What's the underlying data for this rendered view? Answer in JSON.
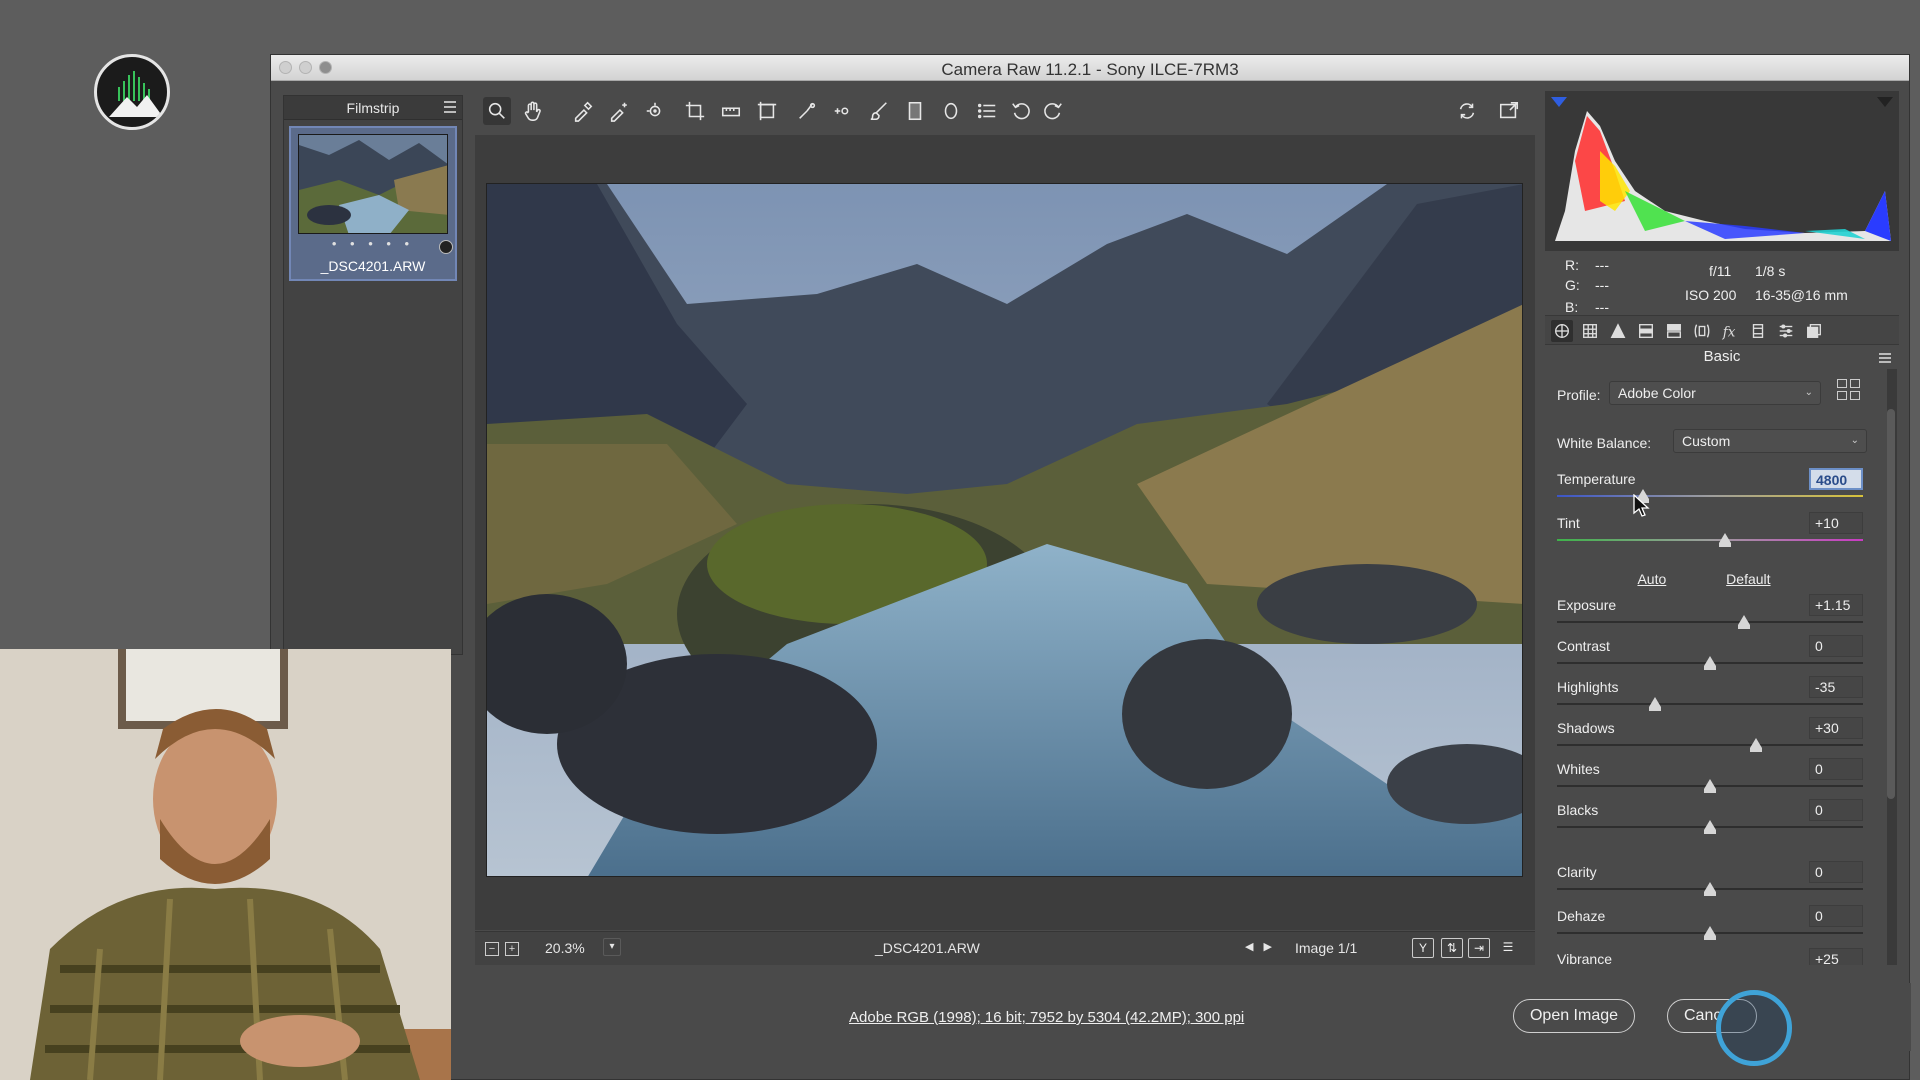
{
  "window": {
    "title": "Camera Raw 11.2.1  -  Sony ILCE-7RM3"
  },
  "filmstrip": {
    "title": "Filmstrip",
    "items": [
      {
        "filename": "_DSC4201.ARW",
        "rating_dots": "• • • • •"
      }
    ]
  },
  "toolbar": {
    "tools": [
      "zoom-icon",
      "hand-icon",
      "white-balance-icon",
      "color-sampler-icon",
      "targeted-adjustment-icon",
      "crop-icon",
      "straighten-icon",
      "transform-icon",
      "spot-removal-icon",
      "red-eye-icon",
      "adjustment-brush-icon",
      "graduated-filter-icon",
      "radial-filter-icon",
      "preferences-icon",
      "rotate-left-icon",
      "rotate-right-icon"
    ],
    "right_tools": [
      "sync-icon",
      "fullscreen-icon"
    ]
  },
  "canvas_footer": {
    "zoom": "20.3%",
    "filename": "_DSC4201.ARW",
    "image_count": "Image 1/1"
  },
  "readout": {
    "r_label": "R:",
    "r_value": "---",
    "g_label": "G:",
    "g_value": "---",
    "b_label": "B:",
    "b_value": "---",
    "aperture": "f/11",
    "shutter": "1/8 s",
    "iso": "ISO 200",
    "lens": "16-35@16 mm"
  },
  "panel": {
    "title": "Basic",
    "profile_label": "Profile:",
    "profile_value": "Adobe Color",
    "wb_label": "White Balance:",
    "wb_value": "Custom",
    "auto": "Auto",
    "default": "Default",
    "sliders": [
      {
        "name": "Temperature",
        "value": "4800",
        "position": 0.28
      },
      {
        "name": "Tint",
        "value": "+10",
        "position": 0.55
      },
      {
        "name": "Exposure",
        "value": "+1.15",
        "position": 0.61
      },
      {
        "name": "Contrast",
        "value": "0",
        "position": 0.5
      },
      {
        "name": "Highlights",
        "value": "-35",
        "position": 0.32
      },
      {
        "name": "Shadows",
        "value": "+30",
        "position": 0.65
      },
      {
        "name": "Whites",
        "value": "0",
        "position": 0.5
      },
      {
        "name": "Blacks",
        "value": "0",
        "position": 0.5
      },
      {
        "name": "Clarity",
        "value": "0",
        "position": 0.5
      },
      {
        "name": "Dehaze",
        "value": "0",
        "position": 0.5
      },
      {
        "name": "Vibrance",
        "value": "+25",
        "position": 0.62
      }
    ]
  },
  "bottom": {
    "workflow_options": "Adobe RGB (1998); 16 bit; 7952 by 5304 (42.2MP); 300 ppi",
    "open_image": "Open Image",
    "cancel": "Canc"
  },
  "colors": {
    "window_bg": "#4a4a4a",
    "accent": "#6c8fc7"
  }
}
